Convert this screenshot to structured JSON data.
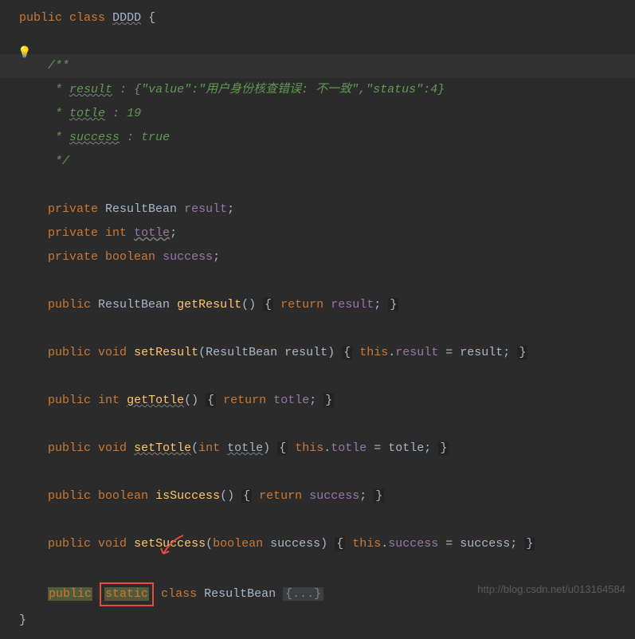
{
  "code": {
    "l1_public": "public",
    "l1_class": "class",
    "l1_name": "DDDD",
    "l1_brace": " {",
    "c1": "/**",
    "c2_star": " * ",
    "c2_key": "result",
    "c2_colon": " : ",
    "c2_val": "{\"value\":\"用户身份核查错误: 不一致\",\"status\":4}",
    "c3_star": " * ",
    "c3_key": "totle",
    "c3_colon": " : ",
    "c3_val": "19",
    "c4_star": " * ",
    "c4_key": "success",
    "c4_colon": " : ",
    "c4_val": "true",
    "c5": " */",
    "f1_private": "private",
    "f1_type": "ResultBean",
    "f1_name": "result",
    "f1_semi": ";",
    "f2_private": "private",
    "f2_type": "int",
    "f2_name": "totle",
    "f2_semi": ";",
    "f3_private": "private",
    "f3_type": "boolean",
    "f3_name": "success",
    "f3_semi": ";",
    "m1_public": "public",
    "m1_type": "ResultBean",
    "m1_name": "getResult",
    "m1_params": "()",
    "m1_ob": "{",
    "m1_return": "return",
    "m1_val": "result",
    "m1_semi": ";",
    "m1_cb": "}",
    "m2_public": "public",
    "m2_void": "void",
    "m2_name": "setResult",
    "m2_op": "(",
    "m2_ptype": "ResultBean",
    "m2_pname": "result",
    "m2_cp": ")",
    "m2_ob": "{",
    "m2_this": "this",
    "m2_dot": ".",
    "m2_field": "result",
    "m2_eq": " = ",
    "m2_val": "result",
    "m2_semi": ";",
    "m2_cb": "}",
    "m3_public": "public",
    "m3_type": "int",
    "m3_name": "getTotle",
    "m3_params": "()",
    "m3_ob": "{",
    "m3_return": "return",
    "m3_val": "totle",
    "m3_semi": ";",
    "m3_cb": "}",
    "m4_public": "public",
    "m4_void": "void",
    "m4_name": "setTotle",
    "m4_op": "(",
    "m4_ptype": "int",
    "m4_pname": "totle",
    "m4_cp": ")",
    "m4_ob": "{",
    "m4_this": "this",
    "m4_dot": ".",
    "m4_field": "totle",
    "m4_eq": " = ",
    "m4_val": "totle",
    "m4_semi": ";",
    "m4_cb": "}",
    "m5_public": "public",
    "m5_type": "boolean",
    "m5_name": "isSuccess",
    "m5_params": "()",
    "m5_ob": "{",
    "m5_return": "return",
    "m5_val": "success",
    "m5_semi": ";",
    "m5_cb": "}",
    "m6_public": "public",
    "m6_void": "void",
    "m6_name": "setSuccess",
    "m6_op": "(",
    "m6_ptype": "boolean",
    "m6_pname": "success",
    "m6_cp": ")",
    "m6_ob": "{",
    "m6_this": "this",
    "m6_dot": ".",
    "m6_field": "success",
    "m6_eq": " = ",
    "m6_val": "success",
    "m6_semi": ";",
    "m6_cb": "}",
    "inner_public": "public",
    "inner_static": "static",
    "inner_class": "class",
    "inner_name": "ResultBean",
    "inner_fold": "{...}",
    "close_brace": "}"
  },
  "watermark": "http://blog.csdn.net/u013164584",
  "bulb": "💡"
}
